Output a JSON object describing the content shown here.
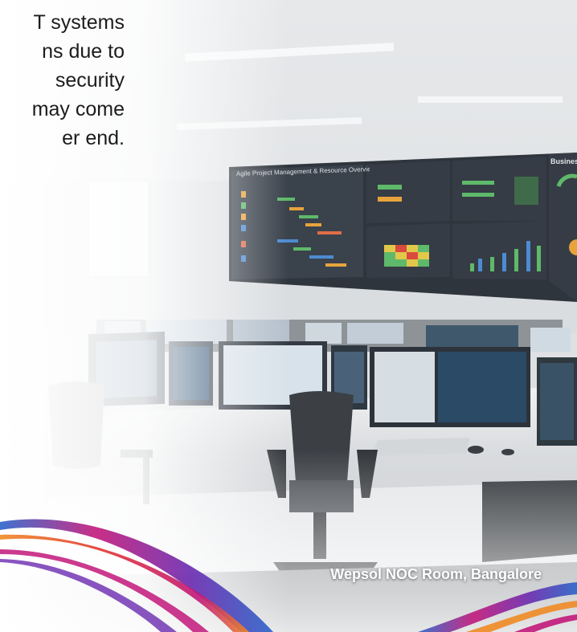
{
  "intro_text": {
    "lines": [
      "T systems",
      "ns due to",
      "security",
      "may come",
      "er end."
    ]
  },
  "caption": {
    "text": "Wepsol NOC Room, Bangalore"
  },
  "video_wall": {
    "main_panel_title": "Agile Project Management & Resource Overview",
    "right_panel_title": "Business"
  },
  "colors": {
    "caption_text": "#ffffff",
    "body_text": "#1c1c1c",
    "wave_magenta": "#c2187a",
    "wave_blue": "#2a63c9",
    "wave_orange": "#f08a24",
    "wave_purple": "#6a2ab0"
  }
}
